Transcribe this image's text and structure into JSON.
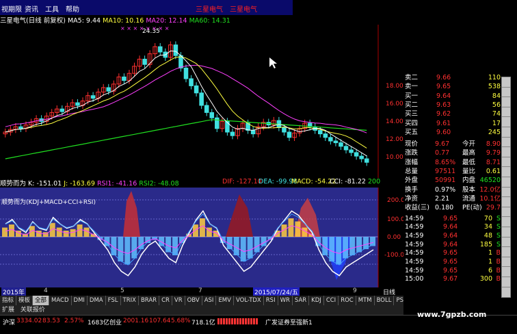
{
  "menu": {
    "items": [
      "视期限",
      "资讯",
      "工具",
      "帮助"
    ],
    "promo": [
      "三星电气",
      "三星电气"
    ]
  },
  "header": {
    "title": "三星电气(日线 前复权)",
    "ma5": "MA5: 9.44",
    "ma10": "MA10: 10.16",
    "ma20": "MA20: 12.14",
    "ma60": "MA60: 14.31",
    "high_label": "24.35"
  },
  "price_axis": [
    "18.00",
    "16.00",
    "14.00",
    "12.00",
    "10.00"
  ],
  "indicator_header": {
    "name": "顺势而为",
    "k": "K: -151.01",
    "j": "J: -163.69",
    "rsi1": "RSI1: -41.16",
    "rsi2": "RSI2: -48.08",
    "dif": "DIF: -127.10",
    "dea": "DEA: -99.98",
    "macd": "MACD: -54.22",
    "cci": "CCI: -81.22",
    "extra": "200",
    "legend": "顺势而为(KDJ+MACD+CCI+RSI)"
  },
  "indicator_axis": [
    "200.0",
    "100.0",
    "0.00",
    "-100.0"
  ],
  "time_axis": [
    "2015年",
    "4",
    "5",
    "2015/07/24/五",
    "7",
    "9",
    "日线"
  ],
  "tabs": [
    "指标",
    "模板",
    "全部",
    "MACD",
    "DMI",
    "DMA",
    "FSL",
    "TRIX",
    "BRAR",
    "CR",
    "VR",
    "OBV",
    "ASI",
    "EMV",
    "VOL-TDX",
    "RSI",
    "WR",
    "SAR",
    "KDJ",
    "CCI",
    "ROC",
    "MTM",
    "BOLL",
    "PSY",
    "MCST"
  ],
  "subtabs": [
    "扩展",
    "关联报价"
  ],
  "quote": {
    "orders": [
      {
        "label": "卖二",
        "price": "9.66",
        "vol": "110"
      },
      {
        "label": "卖一",
        "price": "9.65",
        "vol": "538"
      },
      {
        "label": "买一",
        "price": "9.64",
        "vol": "84"
      },
      {
        "label": "买二",
        "price": "9.63",
        "vol": "56"
      },
      {
        "label": "买三",
        "price": "9.62",
        "vol": "74"
      },
      {
        "label": "买四",
        "price": "9.61",
        "vol": "17"
      },
      {
        "label": "买五",
        "price": "9.60",
        "vol": "245"
      }
    ],
    "stats": [
      {
        "l1": "现价",
        "v1": "9.67",
        "l2": "今开",
        "v2": "8.90"
      },
      {
        "l1": "涨跌",
        "v1": "0.77",
        "l2": "最高",
        "v2": "9.79"
      },
      {
        "l1": "涨幅",
        "v1": "8.65%",
        "l2": "最低",
        "v2": "8.71"
      },
      {
        "l1": "总量",
        "v1": "97511",
        "l2": "量比",
        "v2": "0.61"
      },
      {
        "l1": "外盘",
        "v1": "50991",
        "l2": "内盘",
        "v2": "46520"
      },
      {
        "l1": "换手",
        "v1": "0.97%",
        "l2": "股本",
        "v2": "12.0亿"
      },
      {
        "l1": "净资",
        "v1": "2.21",
        "l2": "流通",
        "v2": "10.1亿"
      },
      {
        "l1": "收益(三)",
        "v1": "0.180",
        "l2": "PE(动)",
        "v2": "29.7"
      }
    ],
    "ticks": [
      {
        "time": "14:59",
        "price": "9.65",
        "vol": "70",
        "dir": "S"
      },
      {
        "time": "14:59",
        "price": "9.64",
        "vol": "34",
        "dir": "S"
      },
      {
        "time": "14:59",
        "price": "9.64",
        "vol": "48",
        "dir": "S"
      },
      {
        "time": "14:59",
        "price": "9.64",
        "vol": "185",
        "dir": "S"
      },
      {
        "time": "14:59",
        "price": "9.65",
        "vol": "1",
        "dir": "B"
      },
      {
        "time": "14:59",
        "price": "9.65",
        "vol": "1",
        "dir": "B"
      },
      {
        "time": "14:59",
        "price": "9.65",
        "vol": "6",
        "dir": "B"
      },
      {
        "time": "15:00",
        "price": "9.67",
        "vol": "300",
        "dir": "B"
      }
    ]
  },
  "status": {
    "sh_label": "沪深",
    "sh_val": "3334.02",
    "sh_chg": "83.53",
    "sh_pct": "2.57%",
    "sh_amt": "1683亿",
    "cy_label": "创业",
    "cy_val": "2001.16",
    "cy_chg": "107.64",
    "cy_pct": "5.68%",
    "cy_amt": "718.1亿",
    "broker": "广发证券至强新1"
  },
  "watermark": "www.7gpzb.com",
  "colors": {
    "up": "#ff3030",
    "down": "#40e0e0",
    "ma5": "#ffffff",
    "ma10": "#ffff40",
    "ma20": "#ff40ff",
    "ma60": "#20e020"
  }
}
